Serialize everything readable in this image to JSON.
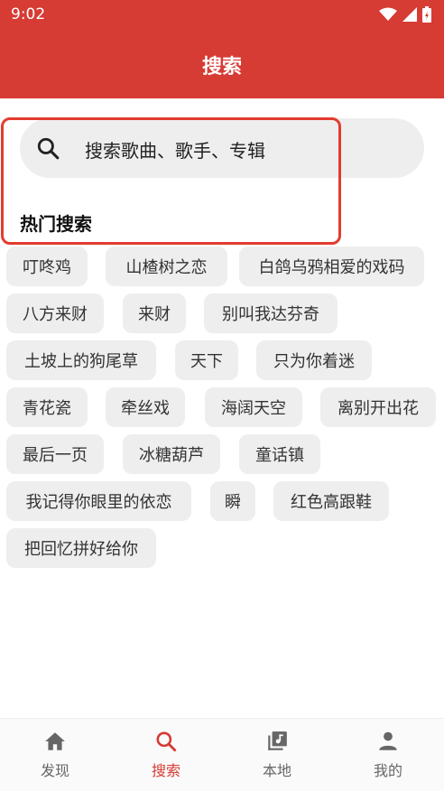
{
  "status_bar": {
    "time": "9:02"
  },
  "app_bar": {
    "title": "搜索"
  },
  "search": {
    "placeholder": "搜索歌曲、歌手、专辑"
  },
  "hot_search": {
    "title": "热门搜索",
    "items": [
      "叮咚鸡",
      "山楂树之恋",
      "白鸽乌鸦相爱的戏码",
      "八方来财",
      "来财",
      "别叫我达芬奇",
      "土坡上的狗尾草",
      "天下",
      "只为你着迷",
      "青花瓷",
      "牵丝戏",
      "海阔天空",
      "离别开出花",
      "最后一页",
      "冰糖葫芦",
      "童话镇",
      "我记得你眼里的依恋",
      "瞬",
      "红色高跟鞋",
      "把回忆拼好给你"
    ]
  },
  "bottom_nav": {
    "items": [
      {
        "label": "发现",
        "icon": "home-icon"
      },
      {
        "label": "搜索",
        "icon": "search-icon"
      },
      {
        "label": "本地",
        "icon": "library-music-icon"
      },
      {
        "label": "我的",
        "icon": "person-icon"
      }
    ],
    "active": "搜索"
  },
  "colors": {
    "primary": "#d63b34",
    "highlight_border": "#e23c2f",
    "chip_bg": "#eeeeee"
  }
}
